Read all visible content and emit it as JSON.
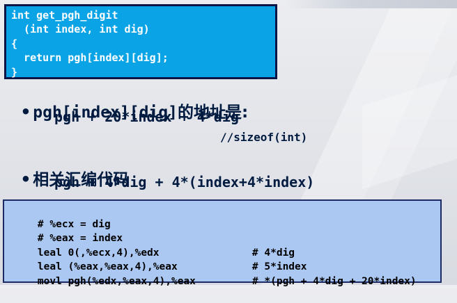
{
  "c_code": [
    "int get_pgh_digit",
    "  (int index, int dig)",
    "{",
    "  return pgh[index][dig];",
    "}"
  ],
  "bullet1": {
    "code": "pgh[index][dig]",
    "suffix": "的地址是:"
  },
  "address_expr": "pgh + 20*index + 4*dig",
  "sizeof_comment": "//sizeof(int)",
  "bullet2": {
    "label": "相关汇编代码"
  },
  "assembly_expr": "pgh + 4*dig + 4*(index+4*index)",
  "asm": [
    {
      "instr": "# %ecx = dig",
      "comment": ""
    },
    {
      "instr": "# %eax = index",
      "comment": ""
    },
    {
      "instr": "leal 0(,%ecx,4),%edx",
      "comment": "# 4*dig"
    },
    {
      "instr": "leal (%eax,%eax,4),%eax",
      "comment": "# 5*index"
    },
    {
      "instr": "movl pgh(%edx,%eax,4),%eax",
      "comment": "# *(pgh + 4*dig + 20*index)"
    }
  ],
  "colors": {
    "code_box_bg": "#0aa3e6",
    "code_box_border": "#0a1446",
    "asm_box_bg": "#abc8f2",
    "text_dark": "#001a40"
  }
}
